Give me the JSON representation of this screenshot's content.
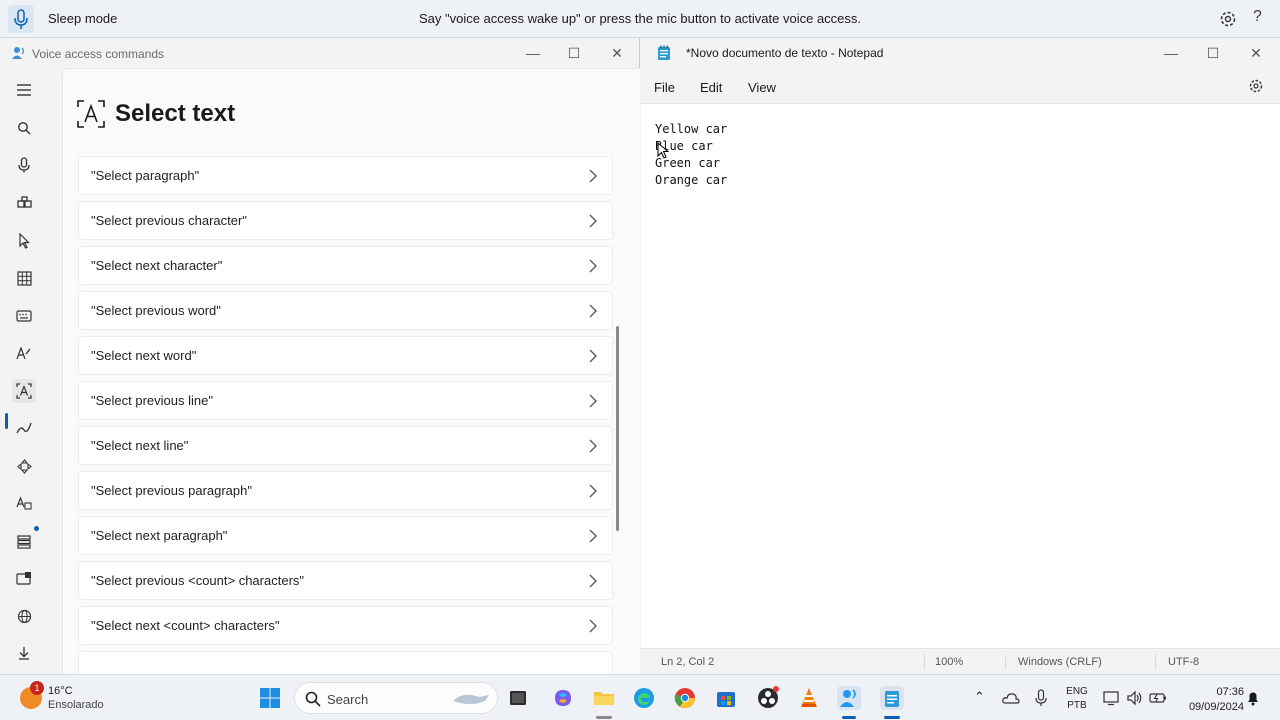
{
  "voice_access_bar": {
    "state": "Sleep mode",
    "message": "Say \"voice access wake up\" or press the mic button to activate voice access.",
    "help": "?"
  },
  "commands_window": {
    "title": "Voice access commands",
    "heading": "Select text",
    "nav_icons": [
      "menu-icon",
      "search-icon",
      "microphone-icon",
      "apps-icon",
      "pointer-icon",
      "grid-icon",
      "keyboard-icon",
      "text-edit-icon",
      "select-text-icon",
      "dictation-icon",
      "move-icon",
      "spelling-icon",
      "settings-icon",
      "screen-icon",
      "language-icon",
      "download-icon"
    ],
    "commands": [
      "\"Select paragraph\"",
      "\"Select previous character\"",
      "\"Select next character\"",
      "\"Select previous word\"",
      "\"Select next word\"",
      "\"Select previous line\"",
      "\"Select next line\"",
      "\"Select previous paragraph\"",
      "\"Select next paragraph\"",
      "\"Select previous <count> characters\"",
      "\"Select next <count> characters\""
    ]
  },
  "notepad": {
    "title": "*Novo documento de texto - Notepad",
    "menu": {
      "file": "File",
      "edit": "Edit",
      "view": "View"
    },
    "lines": [
      "Yellow car",
      "Blue car",
      "Green car",
      "Orange car"
    ],
    "status": {
      "position": "Ln 2, Col 2",
      "zoom": "100%",
      "line_ending": "Windows (CRLF)",
      "encoding": "UTF-8"
    }
  },
  "taskbar": {
    "weather_temp": "16°C",
    "weather_cond": "Ensolarado",
    "weather_badge": "1",
    "search_label": "Search",
    "lang_top": "ENG",
    "lang_bottom": "PTB",
    "time": "07:36",
    "date": "09/09/2024"
  },
  "colors": {
    "accent": "#0a5fb4",
    "window_bg": "#f3f3f3"
  }
}
